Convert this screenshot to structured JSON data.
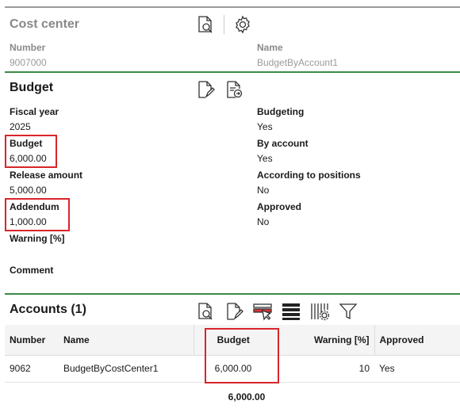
{
  "cost_center": {
    "title": "Cost center",
    "number_label": "Number",
    "number_value": "9007000",
    "name_label": "Name",
    "name_value": "BudgetByAccount1"
  },
  "budget": {
    "title": "Budget",
    "fiscal_year_label": "Fiscal year",
    "fiscal_year_value": "2025",
    "budget_label": "Budget",
    "budget_value": "6,000.00",
    "release_label": "Release amount",
    "release_value": "5,000.00",
    "addendum_label": "Addendum",
    "addendum_value": "1,000.00",
    "warning_label": "Warning [%]",
    "comment_label": "Comment",
    "budgeting_label": "Budgeting",
    "budgeting_value": "Yes",
    "by_account_label": "By account",
    "by_account_value": "Yes",
    "according_label": "According to positions",
    "according_value": "No",
    "approved_label": "Approved",
    "approved_value": "No"
  },
  "accounts": {
    "title": "Accounts (1)",
    "columns": [
      "Number",
      "Name",
      "Budget",
      "Warning [%]",
      "Approved"
    ],
    "rows": [
      [
        "9062",
        "BudgetByCostCenter1",
        "6,000.00",
        "10",
        "Yes"
      ]
    ],
    "total_budget": "6,000.00"
  },
  "icons": [
    "search-document-icon",
    "settings-gear-icon",
    "edit-document-icon",
    "export-document-icon",
    "select-cursor-icon",
    "list-rows-icon",
    "column-settings-icon",
    "filter-funnel-icon"
  ],
  "colors": {
    "section_rule": "#3b8a45",
    "highlight": "#d9252a"
  }
}
